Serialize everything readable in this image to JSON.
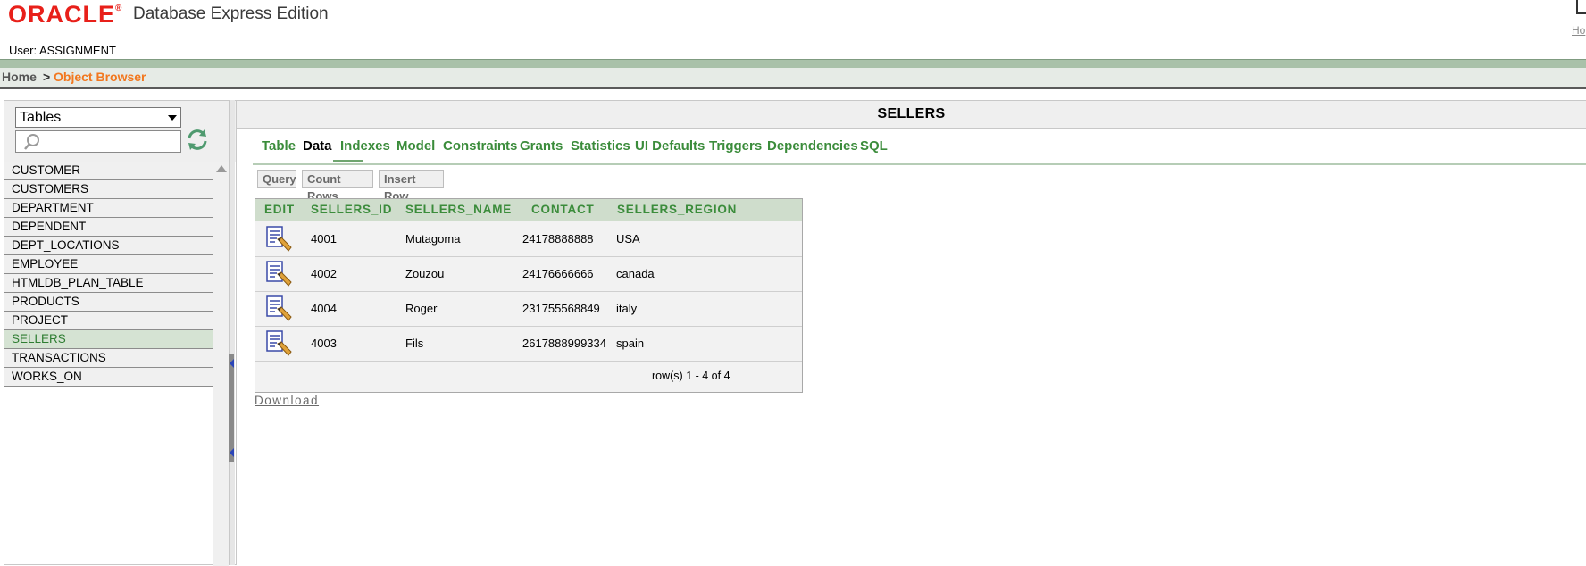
{
  "header": {
    "logo": "ORACLE",
    "product_title": "Database Express Edition",
    "user_label": "User: ASSIGNMENT",
    "corner_link": "Ho"
  },
  "breadcrumb": {
    "home": "Home",
    "separator": ">",
    "current": "Object Browser"
  },
  "sidebar": {
    "type_select": "Tables",
    "search_value": "",
    "items": [
      {
        "label": "CUSTOMER"
      },
      {
        "label": "CUSTOMERS"
      },
      {
        "label": "DEPARTMENT"
      },
      {
        "label": "DEPENDENT"
      },
      {
        "label": "DEPT_LOCATIONS"
      },
      {
        "label": "EMPLOYEE"
      },
      {
        "label": "HTMLDB_PLAN_TABLE"
      },
      {
        "label": "PRODUCTS"
      },
      {
        "label": "PROJECT"
      },
      {
        "label": "SELLERS",
        "selected": true
      },
      {
        "label": "TRANSACTIONS"
      },
      {
        "label": "WORKS_ON"
      }
    ]
  },
  "main": {
    "title": "SELLERS",
    "tabs": [
      "Table",
      "Data",
      "Indexes",
      "Model",
      "Constraints",
      "Grants",
      "Statistics",
      "UI Defaults",
      "Triggers",
      "Dependencies",
      "SQL"
    ],
    "active_tab": "Data",
    "buttons": [
      "Query",
      "Count Rows",
      "Insert Row"
    ],
    "table": {
      "columns": [
        "EDIT",
        "SELLERS_ID",
        "SELLERS_NAME",
        "CONTACT",
        "SELLERS_REGION"
      ],
      "rows": [
        [
          "4001",
          "Mutagoma",
          "24178888888",
          "USA"
        ],
        [
          "4002",
          "Zouzou",
          "24176666666",
          "canada"
        ],
        [
          "4004",
          "Roger",
          "231755568849",
          "italy"
        ],
        [
          "4003",
          "Fils",
          "2617888999334",
          "spain"
        ]
      ],
      "rows_info": "row(s) 1 - 4 of 4"
    },
    "download_label": "Download"
  },
  "colors": {
    "brand_red": "#e8201a",
    "accent_green": "#3b8c3b",
    "breadcrumb_orange": "#f2771e",
    "header_bar": "#a9c1a9"
  }
}
